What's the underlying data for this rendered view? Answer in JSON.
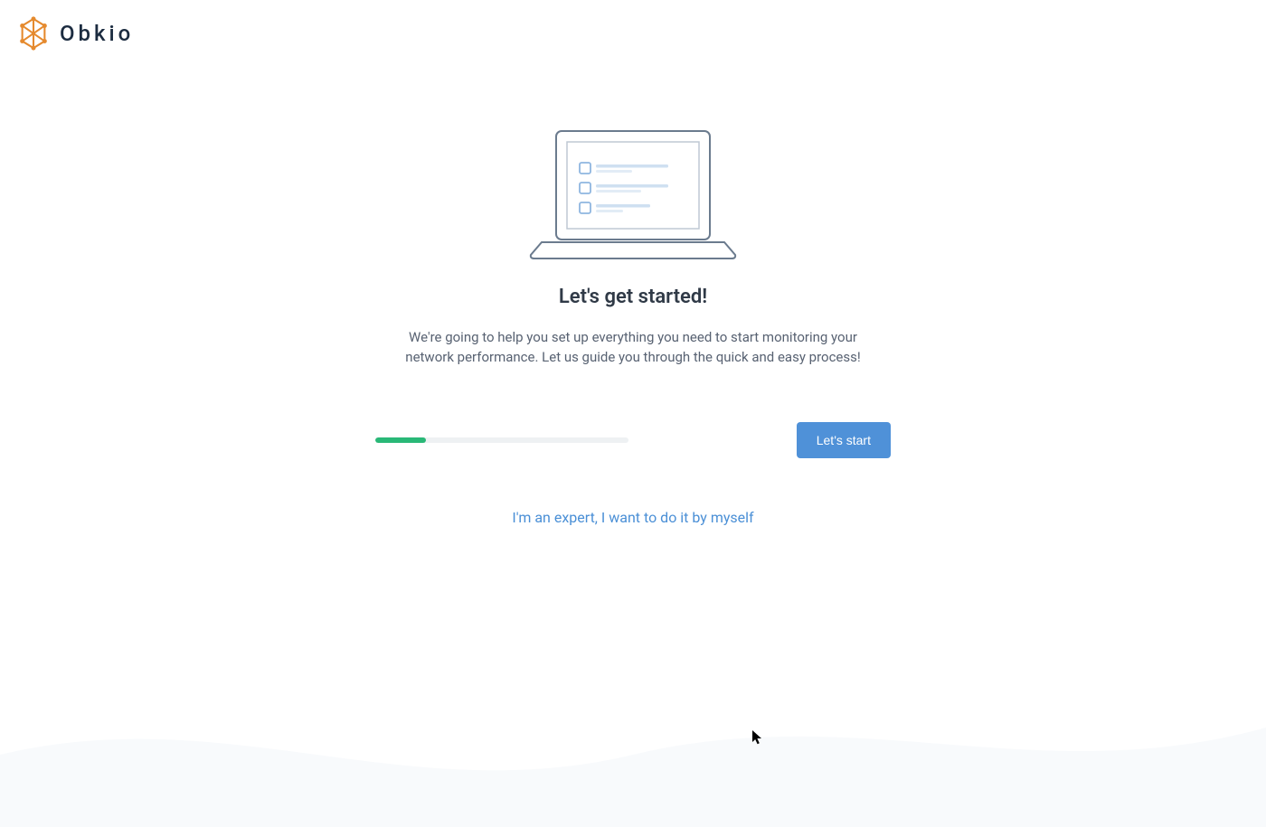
{
  "brand": {
    "name": "Obkio"
  },
  "onboarding": {
    "title": "Let's get started!",
    "description": "We're going to help you set up everything you need to start monitoring your network performance. Let us guide you through the quick and easy process!",
    "start_button_label": "Let's start",
    "expert_link_label": "I'm an expert, I want to do it by myself",
    "progress_percent": 20
  },
  "colors": {
    "brand_orange": "#e58a2e",
    "accent_blue": "#4f91d8",
    "progress_green": "#29b877",
    "text_dark": "#303a47",
    "text_muted": "#586272"
  }
}
